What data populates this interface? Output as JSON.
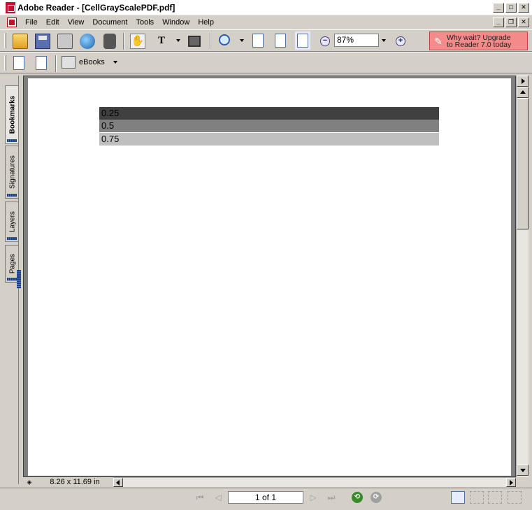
{
  "window": {
    "title": "Adobe Reader - [CellGrayScalePDF.pdf]",
    "controls": {
      "minimize": "_",
      "maximize": "□",
      "close": "✕",
      "restore": "❐"
    }
  },
  "menu": {
    "items": [
      "File",
      "Edit",
      "View",
      "Document",
      "Tools",
      "Window",
      "Help"
    ]
  },
  "toolbar": {
    "zoom_value": "87%",
    "zoom_in_glyph": "+",
    "zoom_out_glyph": "−",
    "upgrade_line1": "Why wait? Upgrade",
    "upgrade_line2": "to Reader 7.0 today",
    "ebooks_label": "eBooks",
    "hand_glyph": "✋",
    "text_glyph": "T"
  },
  "sidebar": {
    "tabs": [
      {
        "label": "Bookmarks",
        "active": true
      },
      {
        "label": "Signatures",
        "active": false
      },
      {
        "label": "Layers",
        "active": false
      },
      {
        "label": "Pages",
        "active": false
      }
    ]
  },
  "document": {
    "rows": [
      {
        "label": "0.25",
        "color": "#404040"
      },
      {
        "label": "0.5",
        "color": "#808080"
      },
      {
        "label": "0.75",
        "color": "#bfbfbf"
      }
    ]
  },
  "status": {
    "page_size": "8.26 x 11.69 in",
    "page_indicator": "1 of 1",
    "nav": {
      "first": "⏮",
      "prev": "◁",
      "next": "▷",
      "last": "⏭",
      "back": "⟲",
      "forward": "⟳"
    }
  }
}
